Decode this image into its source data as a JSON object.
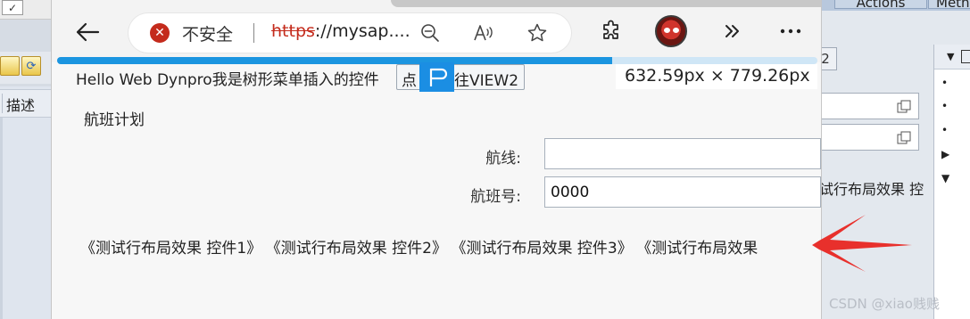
{
  "background_app": {
    "left_column_header": "描述",
    "right_tabs": [
      "Actions",
      "Meth"
    ],
    "right_button": "2",
    "right_text": "试行布局效果 控",
    "watermark": "CSDN @xiao贱贱"
  },
  "browser": {
    "security_label": "不安全",
    "url_scheme": "https",
    "url_rest": "://mysap....",
    "page_load_progress": 0.73
  },
  "page": {
    "hello_text": "Hello Web Dynpro我是树形菜单插入的控件",
    "goto_button": {
      "part1": "点",
      "part2": "往VIEW2"
    },
    "dimensions_tooltip": "632.59px × 779.26px",
    "section_title": "航班计划",
    "fields": [
      {
        "label": "航线:",
        "value": ""
      },
      {
        "label": "航班号:",
        "value": "0000"
      }
    ],
    "controls": [
      "《测试行布局效果 控件1》",
      "《测试行布局效果 控件2》",
      "《测试行布局效果 控件3》",
      "《测试行布局效果"
    ]
  },
  "colors": {
    "accent_blue": "#1b95e0",
    "warning_red": "#c42b1c",
    "arrow_red": "#e8302c"
  }
}
